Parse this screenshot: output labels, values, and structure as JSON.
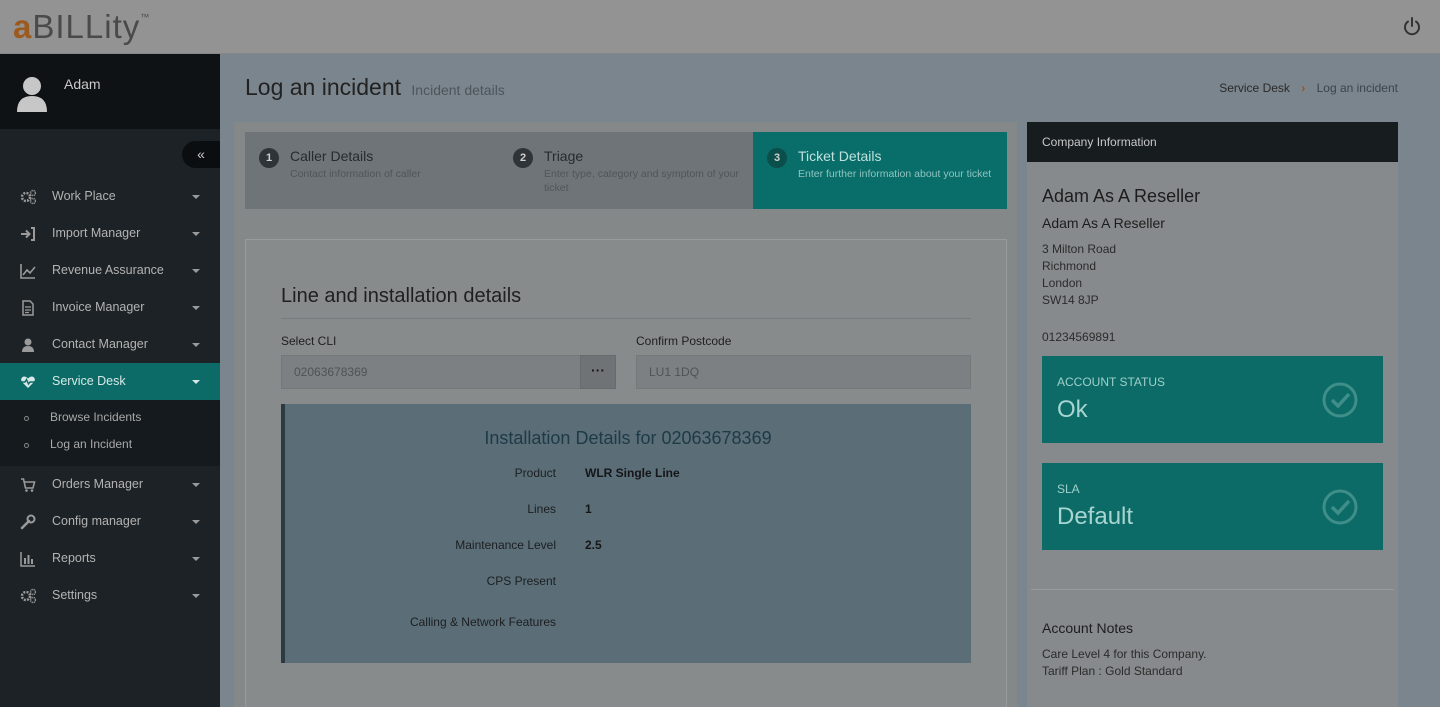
{
  "app": {
    "logo_prefix": "a",
    "logo_rest": "BILLity",
    "logo_tm": "™"
  },
  "user": {
    "name": "Adam"
  },
  "sidebar": {
    "collapse_symbol": "«",
    "items": [
      {
        "label": "Work Place",
        "icon": "cogs-icon"
      },
      {
        "label": "Import Manager",
        "icon": "sign-in-icon"
      },
      {
        "label": "Revenue Assurance",
        "icon": "line-chart-icon"
      },
      {
        "label": "Invoice Manager",
        "icon": "document-icon"
      },
      {
        "label": "Contact Manager",
        "icon": "user-icon"
      },
      {
        "label": "Service Desk",
        "icon": "heartbeat-icon",
        "active": true
      },
      {
        "label": "Orders Manager",
        "icon": "cart-icon"
      },
      {
        "label": "Config manager",
        "icon": "wrench-icon"
      },
      {
        "label": "Reports",
        "icon": "bar-chart-icon"
      },
      {
        "label": "Settings",
        "icon": "cogs-icon"
      }
    ],
    "service_desk_sub": [
      {
        "label": "Browse Incidents"
      },
      {
        "label": "Log an Incident"
      }
    ]
  },
  "page": {
    "title": "Log an incident",
    "subtitle": "Incident details"
  },
  "breadcrumb": {
    "root": "Service Desk",
    "current": "Log an incident"
  },
  "steps": [
    {
      "num": "1",
      "title": "Caller Details",
      "desc": "Contact information of caller"
    },
    {
      "num": "2",
      "title": "Triage",
      "desc": "Enter type, category and symptom of your ticket"
    },
    {
      "num": "3",
      "title": "Ticket Details",
      "desc": "Enter further information about your ticket",
      "active": true
    }
  ],
  "form": {
    "section_title": "Line and installation details",
    "cli_label": "Select CLI",
    "cli_value": "02063678369",
    "cli_button": "···",
    "postcode_label": "Confirm Postcode",
    "postcode_placeholder": "LU1 1DQ"
  },
  "installation": {
    "title": "Installation Details for 02063678369",
    "rows": [
      {
        "label": "Product",
        "value": "WLR Single Line"
      },
      {
        "label": "Lines",
        "value": "1"
      },
      {
        "label": "Maintenance Level",
        "value": "2.5"
      },
      {
        "label": "CPS Present",
        "value": ""
      },
      {
        "label": "Calling & Network Features",
        "value": ""
      }
    ]
  },
  "company": {
    "header": "Company Information",
    "name": "Adam As A Reseller",
    "name2": "Adam As A Reseller",
    "address": [
      "3 Milton Road",
      "Richmond",
      "London",
      "SW14 8JP"
    ],
    "phone": "01234569891",
    "account_status": {
      "label": "ACCOUNT STATUS",
      "value": "Ok"
    },
    "sla": {
      "label": "SLA",
      "value": "Default"
    },
    "notes_title": "Account Notes",
    "notes": [
      "Care Level 4 for this Company.",
      "Tariff Plan : Gold Standard"
    ]
  },
  "colors": {
    "accent": "#0c6b66",
    "sidebar": "#1c2226",
    "brand_orange": "#9c5a1e"
  }
}
